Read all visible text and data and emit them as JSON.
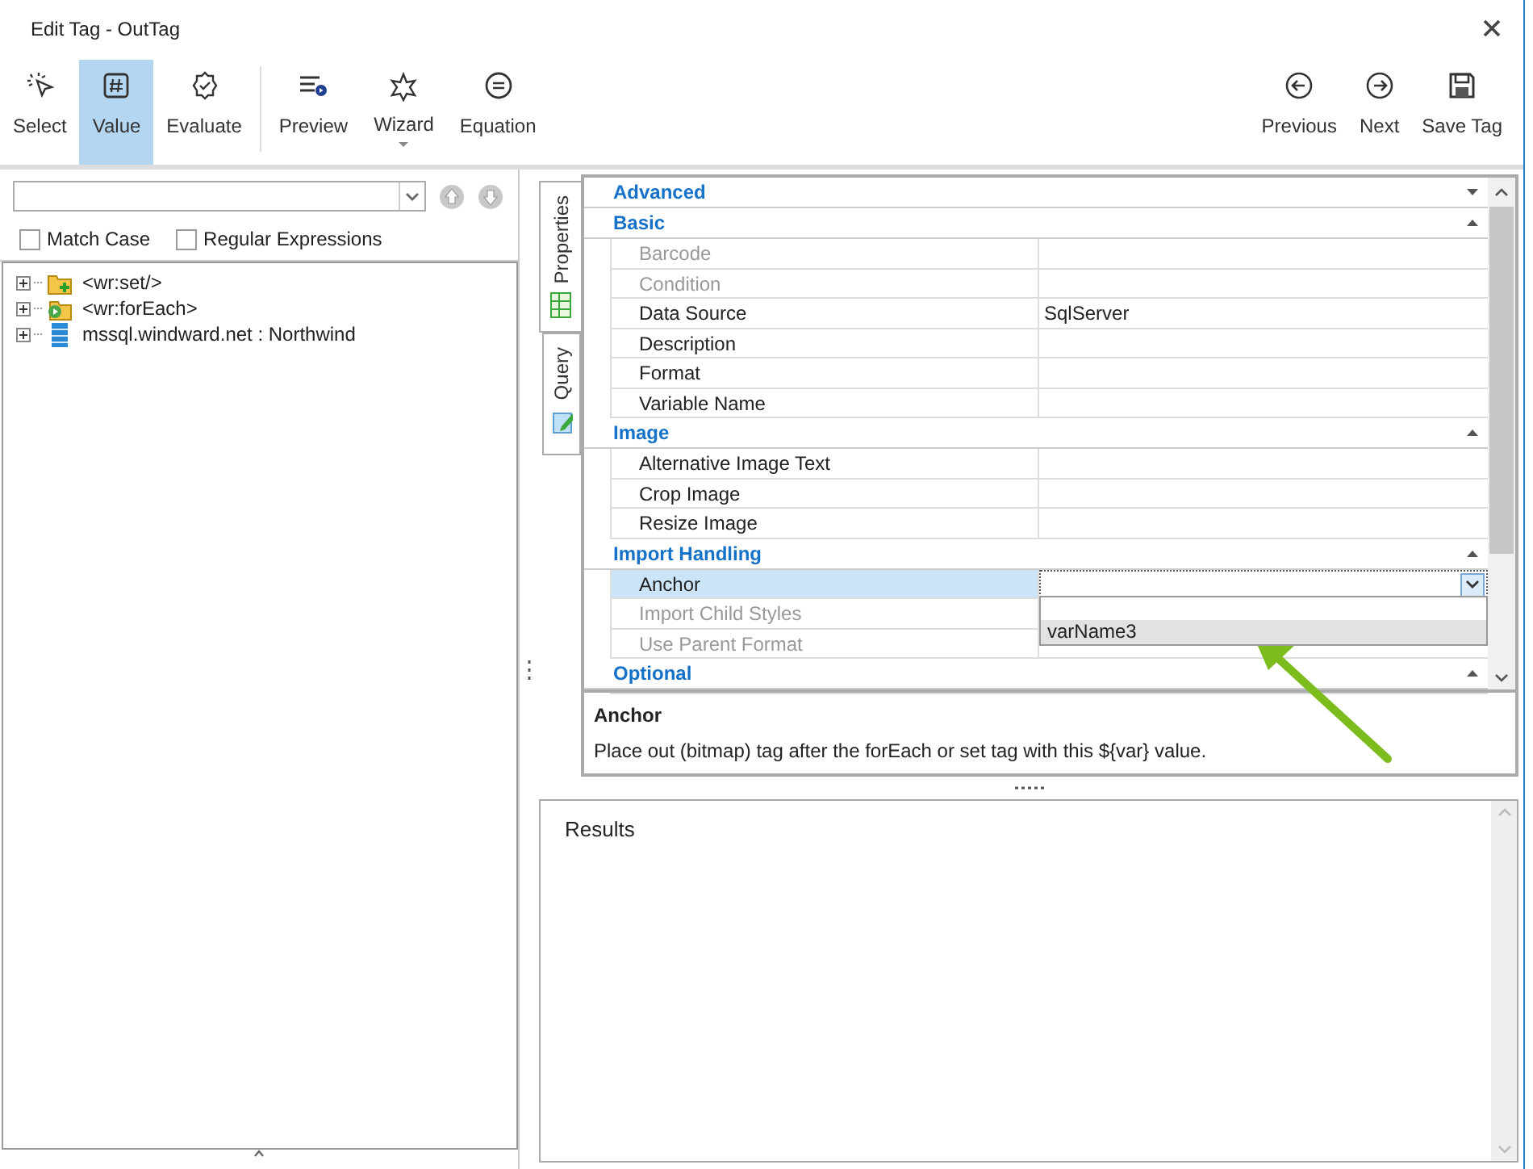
{
  "window": {
    "title": "Edit Tag - OutTag"
  },
  "toolbar": {
    "groups": [
      [
        {
          "label": "Select",
          "selected": false,
          "has_menu": false
        },
        {
          "label": "Value",
          "selected": true,
          "has_menu": false
        },
        {
          "label": "Evaluate",
          "selected": false,
          "has_menu": false
        }
      ],
      [
        {
          "label": "Preview",
          "selected": false,
          "has_menu": false
        },
        {
          "label": "Wizard",
          "selected": false,
          "has_menu": true
        },
        {
          "label": "Equation",
          "selected": false,
          "has_menu": false
        }
      ]
    ],
    "right": [
      {
        "label": "Previous"
      },
      {
        "label": "Next"
      },
      {
        "label": "Save Tag"
      }
    ]
  },
  "search": {
    "options": [
      {
        "label": "Match Case",
        "checked": false
      },
      {
        "label": "Regular Expressions",
        "checked": false
      }
    ]
  },
  "tree": [
    {
      "label": "<wr:set/>",
      "kind": "set",
      "expanded": false
    },
    {
      "label": "<wr:forEach>",
      "kind": "foreach",
      "expanded": false
    },
    {
      "label": "mssql.windward.net : Northwind",
      "kind": "datasource",
      "expanded": false
    }
  ],
  "side_tabs": [
    {
      "label": "Properties",
      "selected": true
    },
    {
      "label": "Query",
      "selected": false
    }
  ],
  "property_grid": {
    "categories": [
      {
        "name": "Advanced",
        "expanded": false
      },
      {
        "name": "Basic",
        "expanded": true,
        "properties": [
          {
            "name": "Barcode",
            "disabled": true,
            "selected": false
          },
          {
            "name": "Condition",
            "disabled": true,
            "selected": false
          },
          {
            "name": "Data Source",
            "value": "SqlServer",
            "disabled": false,
            "selected": false
          },
          {
            "name": "Description",
            "disabled": false,
            "selected": false
          },
          {
            "name": "Format",
            "disabled": false,
            "selected": false
          },
          {
            "name": "Variable Name",
            "disabled": false,
            "selected": false
          }
        ]
      },
      {
        "name": "Image",
        "expanded": true,
        "properties": [
          {
            "name": "Alternative Image Text",
            "disabled": false,
            "selected": false
          },
          {
            "name": "Crop Image",
            "disabled": false,
            "selected": false
          },
          {
            "name": "Resize Image",
            "disabled": false,
            "selected": false
          }
        ]
      },
      {
        "name": "Import Handling",
        "expanded": true,
        "properties": [
          {
            "name": "Anchor",
            "disabled": false,
            "selected": true,
            "dropdown": {
              "options": [
                {
                  "label": "varName3",
                  "selected": true
                }
              ]
            }
          },
          {
            "name": "Import Child Styles",
            "disabled": true,
            "selected": false
          },
          {
            "name": "Use Parent Format",
            "disabled": true,
            "selected": false
          }
        ]
      },
      {
        "name": "Optional",
        "expanded": true
      }
    ]
  },
  "description": {
    "title": "Anchor",
    "text": "Place out (bitmap) tag after the forEach or set tag with this ${var} value."
  },
  "results": {
    "label": "Results"
  }
}
